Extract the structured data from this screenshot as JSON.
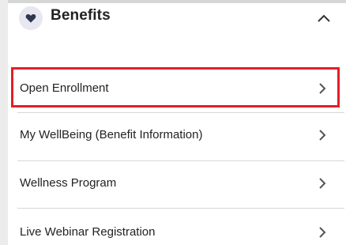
{
  "section": {
    "title": "Benefits",
    "icon": "heart-icon",
    "expanded": true,
    "toggle_icon": "chevron-up-icon"
  },
  "menu": {
    "items": [
      {
        "label": "Open Enrollment",
        "icon": "chevron-right-icon",
        "highlighted": true
      },
      {
        "label": "My WellBeing (Benefit Information)",
        "icon": "chevron-right-icon",
        "highlighted": false
      },
      {
        "label": "Wellness Program",
        "icon": "chevron-right-icon",
        "highlighted": false
      },
      {
        "label": "Live Webinar Registration",
        "icon": "chevron-right-icon",
        "highlighted": false
      }
    ]
  },
  "colors": {
    "highlight_border": "#e21f26",
    "badge_bg": "#e6e7ef",
    "heart": "#2f3550",
    "chevron": "#555555"
  }
}
